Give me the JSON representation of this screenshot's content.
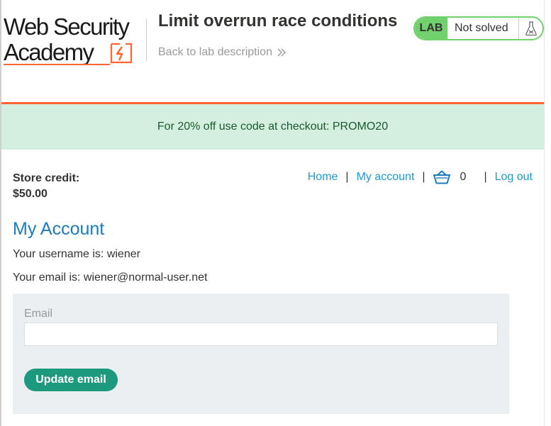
{
  "header": {
    "logo_line1": "Web Security",
    "logo_line2": "Academy",
    "lab_title": "Limit overrun race conditions",
    "back_link": "Back to lab description",
    "lab_badge": "LAB",
    "lab_status": "Not solved",
    "accent_color": "#ff6633",
    "status_color": "#70d16d"
  },
  "promo": {
    "text": "For 20% off use code at checkout: PROMO20",
    "background": "#d4efdf"
  },
  "store_credit": {
    "label": "Store credit:",
    "value": "$50.00"
  },
  "nav": {
    "home": "Home",
    "my_account": "My account",
    "cart_count": "0",
    "log_out": "Log out",
    "separator": "|",
    "cart_icon": "basket-icon"
  },
  "account": {
    "heading": "My Account",
    "username_line": "Your username is: wiener",
    "email_line": "Your email is: wiener@normal-user.net"
  },
  "form": {
    "email_label": "Email",
    "email_value": "",
    "submit_label": "Update email",
    "button_color": "#1d9a7e"
  }
}
